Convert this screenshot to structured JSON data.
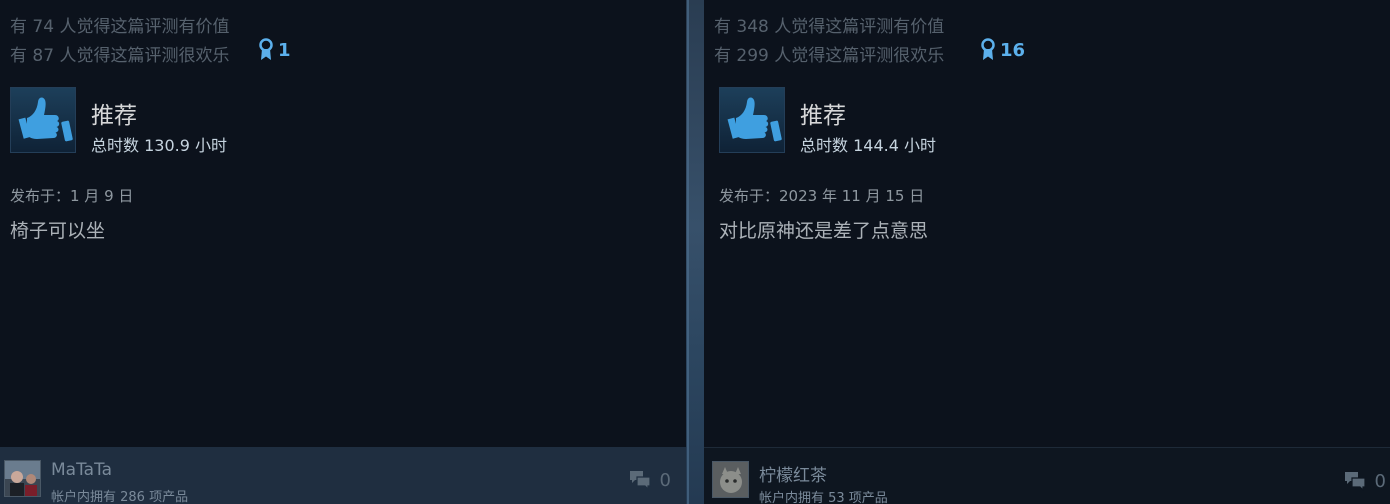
{
  "reviews": [
    {
      "helpful_text": "有 74 人觉得这篇评测有价值",
      "funny_text": "有 87 人觉得这篇评测很欢乐",
      "award_count": "1",
      "recommendation": "推荐",
      "hours": "总时数 130.9 小时",
      "posted": "发布于：1 月 9 日",
      "body": "椅子可以坐",
      "author": "MaTaTa",
      "products_owned": "帐户内拥有 286 项产品",
      "comment_count": "0"
    },
    {
      "helpful_text": "有 348 人觉得这篇评测有价值",
      "funny_text": "有 299 人觉得这篇评测很欢乐",
      "award_count": "16",
      "recommendation": "推荐",
      "hours": "总时数 144.4 小时",
      "posted": "发布于：2023 年 11 月 15 日",
      "body": "对比原神还是差了点意思",
      "author": "柠檬红茶",
      "products_owned": "帐户内拥有 53 项产品",
      "comment_count": "0"
    }
  ],
  "colors": {
    "award": "#5cb0ec",
    "card_bg": "#0c121c",
    "thumb": "#3f9fe0"
  },
  "icons": {
    "award": "award-ribbon-icon",
    "thumb": "thumbs-up-icon",
    "comment": "comment-bubbles-icon"
  }
}
